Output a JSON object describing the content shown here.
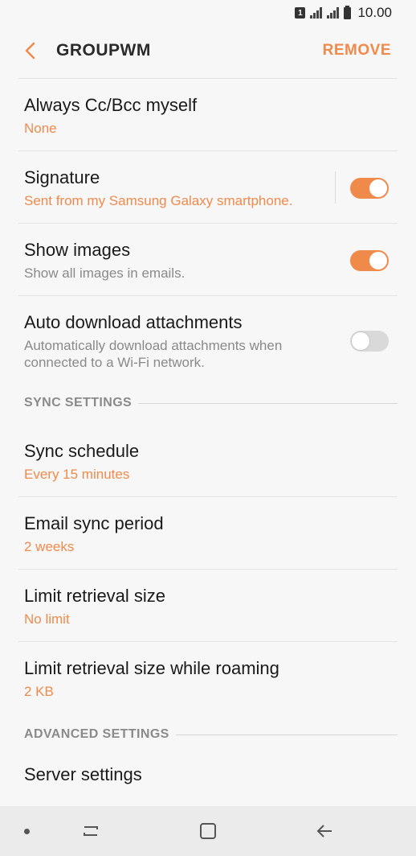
{
  "status_bar": {
    "sim": "1",
    "time": "10.00"
  },
  "header": {
    "title": "GROUPWM",
    "remove_label": "REMOVE"
  },
  "settings": [
    {
      "title": "Always Cc/Bcc myself",
      "subtitle": "None"
    },
    {
      "title": "Signature",
      "subtitle": "Sent from my Samsung Galaxy smartphone.",
      "toggle": "on"
    },
    {
      "title": "Show images",
      "subtitle": "Show all images in emails.",
      "toggle": "on"
    },
    {
      "title": "Auto download attachments",
      "subtitle_line1": "Automatically download attachments when",
      "subtitle_line2": "connected to a Wi-Fi network.",
      "toggle": "off"
    }
  ],
  "sync_section": {
    "header": "SYNC SETTINGS",
    "items": [
      {
        "title": "Sync schedule",
        "subtitle": "Every 15 minutes"
      },
      {
        "title": "Email sync period",
        "subtitle": "2 weeks"
      },
      {
        "title": "Limit retrieval size",
        "subtitle": "No limit"
      },
      {
        "title": "Limit retrieval size while roaming",
        "subtitle": "2 KB"
      }
    ]
  },
  "advanced_section": {
    "header": "ADVANCED SETTINGS",
    "items": [
      {
        "title": "Server settings"
      }
    ]
  },
  "colors": {
    "accent": "#f08a4b",
    "background": "#f7f7f7",
    "nav_bar": "#ebebeb"
  }
}
